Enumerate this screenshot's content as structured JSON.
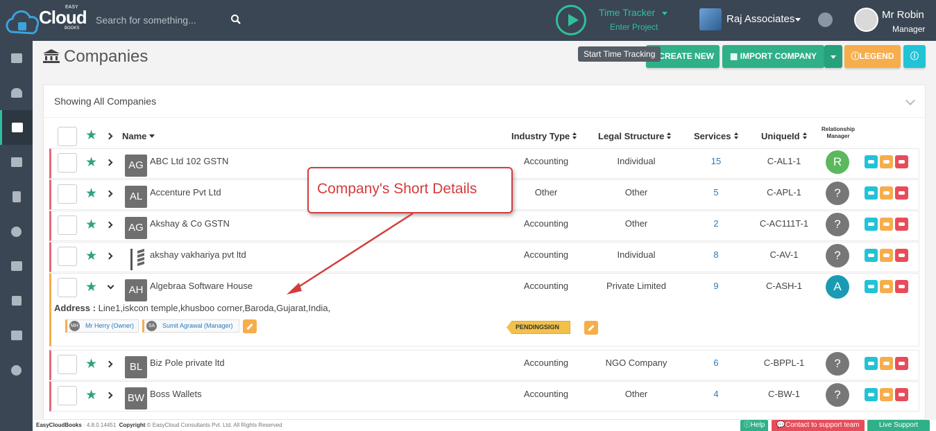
{
  "app": {
    "logo_easy": "EASY",
    "logo_main": "Cloud",
    "logo_books": "BOOKS"
  },
  "search": {
    "placeholder": "Search for something..."
  },
  "time_tracker": {
    "title": "Time Tracker",
    "subtitle": "Enter Project",
    "tooltip": "Start Time Tracking"
  },
  "org": {
    "name": "Raj Associates"
  },
  "user": {
    "name": "Mr Robin",
    "role": "Manager"
  },
  "page": {
    "title": "Companies"
  },
  "buttons": {
    "create": "CREATE NEW",
    "import": "IMPORT COMPANY",
    "legend": "LEGEND"
  },
  "panel": {
    "title": "Showing All Companies"
  },
  "columns": {
    "name": "Name",
    "industry": "Industry Type",
    "legal": "Legal Structure",
    "services": "Services",
    "unique": "UniqueId",
    "rm": "Relationship Manager"
  },
  "rows": [
    {
      "initials": "AG",
      "name": "ABC Ltd 102 GSTN",
      "industry": "Accounting",
      "legal": "Individual",
      "services": "15",
      "unique": "C-AL1-1",
      "rm": "R",
      "rm_color": "#5cb85c"
    },
    {
      "initials": "AL",
      "name": "Accenture Pvt Ltd",
      "industry": "Other",
      "legal": "Other",
      "services": "5",
      "unique": "C-APL-1",
      "rm": "?",
      "rm_color": "#777777"
    },
    {
      "initials": "AG",
      "name": "Akshay & Co GSTN",
      "industry": "Accounting",
      "legal": "Other",
      "services": "2",
      "unique": "C-AC111T-1",
      "rm": "?",
      "rm_color": "#777777"
    },
    {
      "initials": "",
      "name": "akshay vakhariya pvt ltd",
      "industry": "Accounting",
      "legal": "Individual",
      "services": "8",
      "unique": "C-AV-1",
      "rm": "?",
      "rm_color": "#777777"
    },
    {
      "initials": "AH",
      "name": "Algebraa Software House",
      "industry": "Accounting",
      "legal": "Private Limited",
      "services": "9",
      "unique": "C-ASH-1",
      "rm": "A",
      "rm_color": "#1a9bb3"
    },
    {
      "initials": "BL",
      "name": "Biz Pole private ltd",
      "industry": "Accounting",
      "legal": "NGO Company",
      "services": "6",
      "unique": "C-BPPL-1",
      "rm": "?",
      "rm_color": "#777777"
    },
    {
      "initials": "BW",
      "name": "Boss Wallets",
      "industry": "Accounting",
      "legal": "Other",
      "services": "4",
      "unique": "C-BW-1",
      "rm": "?",
      "rm_color": "#777777"
    }
  ],
  "expanded": {
    "address_label": "Address :",
    "address": "Line1,iskcon temple,khusboo corner,Baroda,Gujarat,India,",
    "tags": [
      {
        "initials": "MH",
        "text": "Mr Herry (Owner)"
      },
      {
        "initials": "SA",
        "text": "Sumit Agrawal (Manager)"
      }
    ],
    "status": "PENDINGSIGN"
  },
  "callout": {
    "text": "Company's Short Details"
  },
  "footer": {
    "brand": "EasyCloudBooks",
    "version": "· 4.8.0.14451",
    "copyright_label": "Copyright",
    "copyright": "© EasyCloud Consultants Pvt. Ltd. All Rights Reserved",
    "help": "Help",
    "contact": "Contact to support team",
    "live": "Live Support"
  }
}
